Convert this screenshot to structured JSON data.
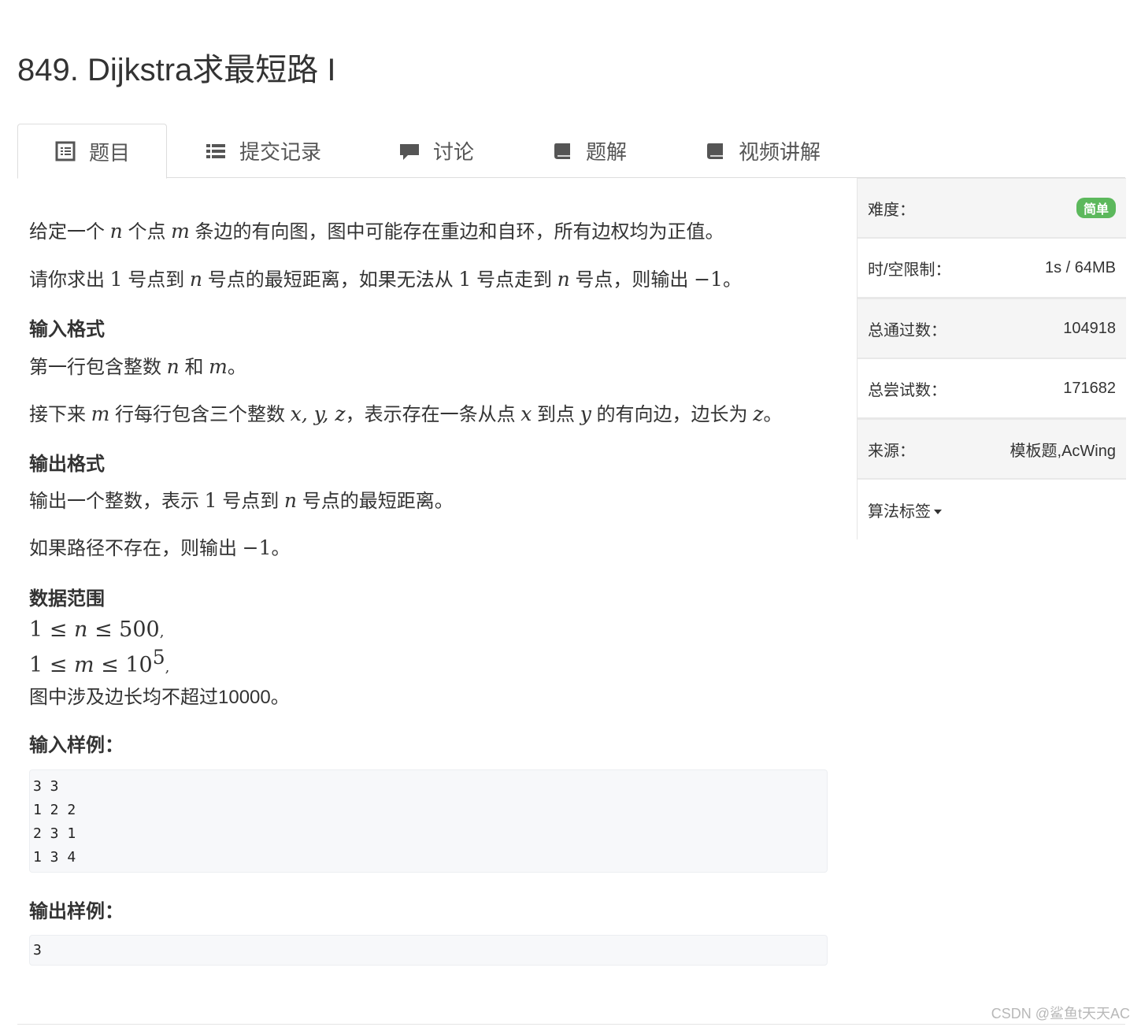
{
  "page": {
    "title": "849. Dijkstra求最短路 I"
  },
  "tabs": [
    {
      "label": "题目",
      "icon": "list-alt-icon",
      "active": true
    },
    {
      "label": "提交记录",
      "icon": "list-icon",
      "active": false
    },
    {
      "label": "讨论",
      "icon": "comment-icon",
      "active": false
    },
    {
      "label": "题解",
      "icon": "book-icon",
      "active": false
    },
    {
      "label": "视频讲解",
      "icon": "book-icon",
      "active": false
    }
  ],
  "problem": {
    "p1": {
      "a": "给定一个 ",
      "b": "n",
      "c": " 个点 ",
      "d": "m",
      "e": " 条边的有向图，图中可能存在重边和自环，所有边权均为正值。"
    },
    "p2": {
      "a": "请你求出 ",
      "b": "1",
      "c": " 号点到 ",
      "d": "n",
      "e": " 号点的最短距离，如果无法从 ",
      "f": "1",
      "g": " 号点走到 ",
      "h": "n",
      "i": " 号点，则输出 ",
      "j": "−1",
      "k": "。"
    },
    "input_head": "输入格式",
    "in1": {
      "a": "第一行包含整数 ",
      "b": "n",
      "c": " 和 ",
      "d": "m",
      "e": "。"
    },
    "in2": {
      "a": "接下来 ",
      "b": "m",
      "c": " 行每行包含三个整数 ",
      "d": "x, y, z",
      "e": "，表示存在一条从点 ",
      "f": "x",
      "g": " 到点 ",
      "h": "y",
      "i": " 的有向边，边长为 ",
      "j": "z",
      "k": "。"
    },
    "output_head": "输出格式",
    "out1": {
      "a": "输出一个整数，表示 ",
      "b": "1",
      "c": " 号点到 ",
      "d": "n",
      "e": " 号点的最短距离。"
    },
    "out2": {
      "a": "如果路径不存在，则输出 ",
      "b": "−1",
      "c": "。"
    },
    "range_head": "数据范围",
    "r1": {
      "a": "1 ≤ ",
      "b": "n",
      "c": " ≤ 500",
      "d": ","
    },
    "r2": {
      "a": "1 ≤ ",
      "b": "m",
      "c": " ≤ 10",
      "sup": "5",
      "d": ","
    },
    "r3": "图中涉及边长均不超过10000。",
    "sample_in_head": "输入样例：",
    "sample_in": [
      "3 3",
      "1 2 2",
      "2 3 1",
      "1 3 4"
    ],
    "sample_out_head": "输出样例：",
    "sample_out": [
      "3"
    ]
  },
  "sidebar": {
    "difficulty_label": "难度：",
    "difficulty_value": "简单",
    "limit_label": "时/空限制：",
    "limit_value": "1s / 64MB",
    "passed_label": "总通过数：",
    "passed_value": "104918",
    "tried_label": "总尝试数：",
    "tried_value": "171682",
    "source_label": "来源：",
    "source_value": "模板题,AcWing",
    "tags_label": "算法标签"
  },
  "watermark": "CSDN @鲨鱼t天天AC",
  "colors": {
    "badge": "#5cb85c",
    "code_bg": "#f7f8fa",
    "side_shade": "#f5f5f5"
  }
}
